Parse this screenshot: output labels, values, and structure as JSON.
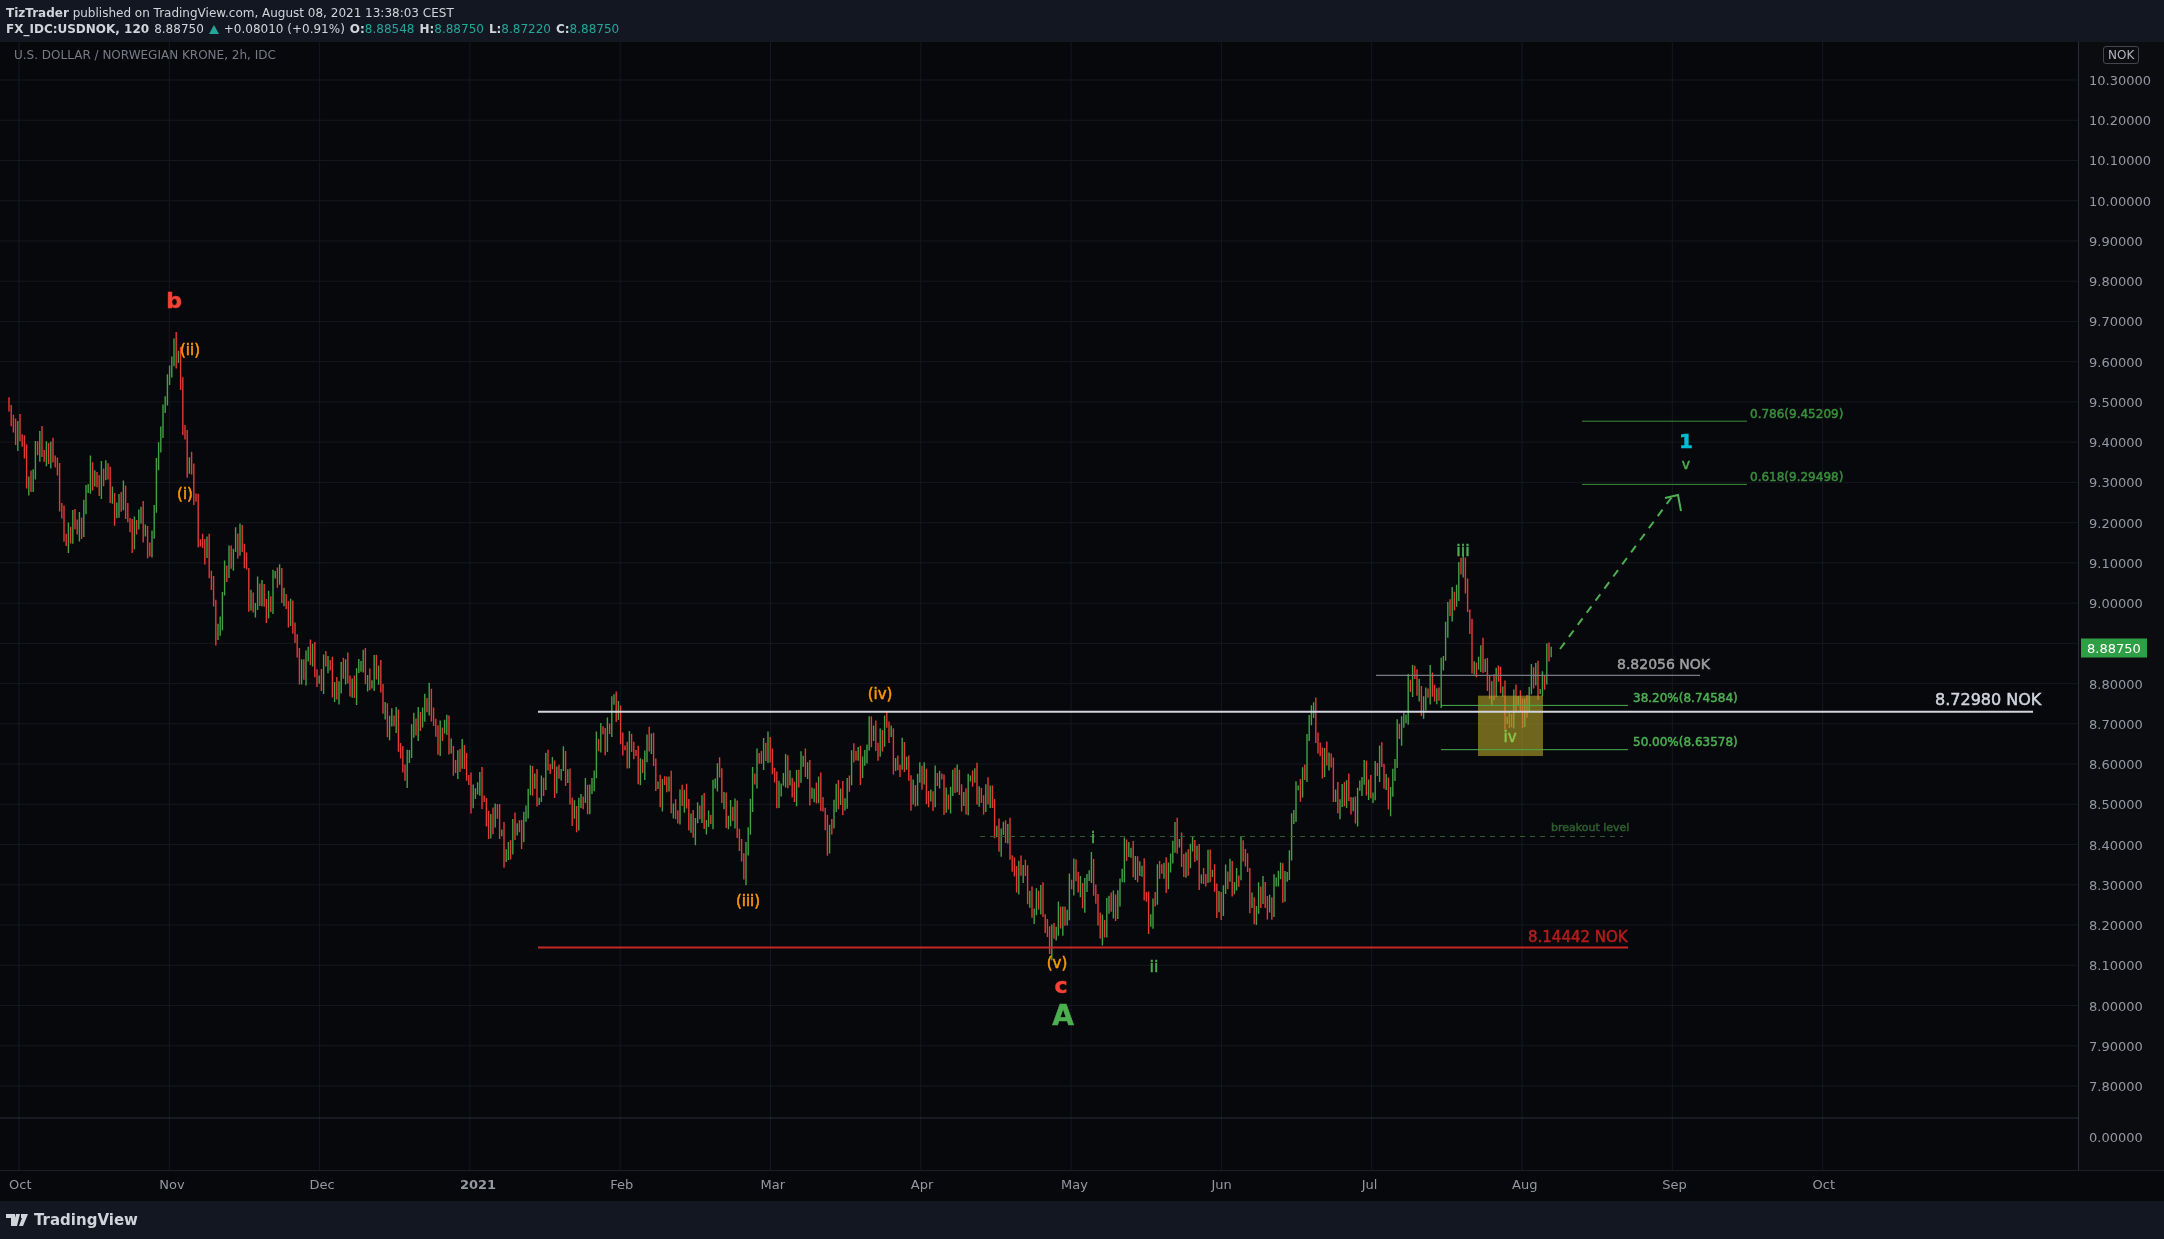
{
  "header": {
    "published": "**TizTrader** published on TradingView.com, August 08, 2021 13:38:03 CEST"
  },
  "symbol_bar": {
    "symbol": "FX_IDC:USDNOK, 120",
    "last": "8.88750",
    "change": "+0.08010 (+0.91%)",
    "ohlc": [
      {
        "label": "O:",
        "value": "8.88548"
      },
      {
        "label": "H:",
        "value": "8.88750"
      },
      {
        "label": "L:",
        "value": "8.87220"
      },
      {
        "label": "C:",
        "value": "8.88750"
      }
    ]
  },
  "chart": {
    "title": "U.S. DOLLAR / NORWEGIAN KRONE, 2h, IDC",
    "annotations": [
      {
        "text": "b",
        "color": "#f44336"
      },
      {
        "text": "(ii)",
        "color": "#ff9800"
      },
      {
        "text": "(i)",
        "color": "#ff9800"
      },
      {
        "text": "(iii)",
        "color": "#ff9800"
      },
      {
        "text": "(iv)",
        "color": "#ff9800"
      },
      {
        "text": "(v)",
        "color": "#ff9800"
      },
      {
        "text": "c",
        "color": "#f44336"
      },
      {
        "text": "A",
        "color": "#4caf50"
      },
      {
        "text": "i",
        "color": "#4caf50"
      },
      {
        "text": "ii",
        "color": "#4caf50"
      },
      {
        "text": "iii",
        "color": "#4caf50"
      },
      {
        "text": "iv",
        "color": "#8bc34a"
      },
      {
        "text": "1",
        "color": "#00bcd4"
      },
      {
        "text": "v",
        "color": "#4caf50"
      },
      {
        "text": "0.786(9.45209)",
        "color": "#388e3c"
      },
      {
        "text": "0.618(9.29498)",
        "color": "#388e3c"
      },
      {
        "text": "8.82056 NOK",
        "color": "#9e9e9e"
      },
      {
        "text": "38.20%(8.74584)",
        "color": "#4caf50"
      },
      {
        "text": "50.00%(8.63578)",
        "color": "#4caf50"
      },
      {
        "text": "8.72980 NOK",
        "color": "#d1d4dc"
      },
      {
        "text": "breakout level",
        "color": "#2e5e2e"
      },
      {
        "text": "8.14442 NOK",
        "color": "#b71c1c"
      }
    ],
    "price_axis": {
      "currency": "NOK",
      "last_price": "8.88750",
      "ticks": [
        "10.30000",
        "10.20000",
        "10.10000",
        "10.00000",
        "9.90000",
        "9.80000",
        "9.70000",
        "9.60000",
        "9.50000",
        "9.40000",
        "9.30000",
        "9.20000",
        "9.10000",
        "9.00000",
        "8.80000",
        "8.70000",
        "8.60000",
        "8.50000",
        "8.40000",
        "8.30000",
        "8.20000",
        "8.10000",
        "8.00000",
        "7.90000",
        "7.80000",
        "0.00000"
      ]
    },
    "time_axis": [
      {
        "label": "Oct",
        "bold": false
      },
      {
        "label": "Nov",
        "bold": false
      },
      {
        "label": "Dec",
        "bold": false
      },
      {
        "label": "2021",
        "bold": true
      },
      {
        "label": "Feb",
        "bold": false
      },
      {
        "label": "Mar",
        "bold": false
      },
      {
        "label": "Apr",
        "bold": false
      },
      {
        "label": "May",
        "bold": false
      },
      {
        "label": "Jun",
        "bold": false
      },
      {
        "label": "Jul",
        "bold": false
      },
      {
        "label": "Aug",
        "bold": false
      },
      {
        "label": "Sep",
        "bold": false
      },
      {
        "label": "Oct",
        "bold": false
      }
    ]
  },
  "footer": {
    "brand": "TradingView"
  }
}
